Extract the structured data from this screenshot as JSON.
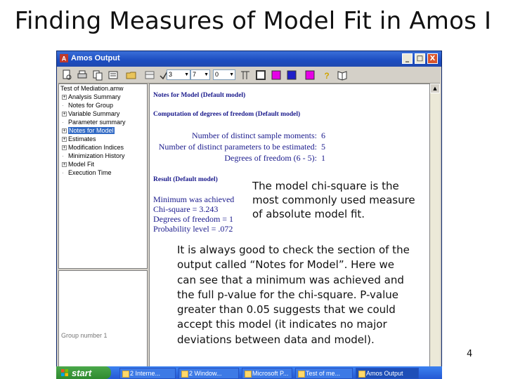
{
  "slide": {
    "title": "Finding Measures of Model Fit in Amos I",
    "page_number": "4"
  },
  "window": {
    "title": "Amos Output",
    "buttons": {
      "minimize": "_",
      "maximize": "□",
      "close": "X"
    }
  },
  "toolbar": {
    "combo1": "3",
    "combo2": "7",
    "combo3": "0",
    "icons": [
      "preview-icon",
      "print-icon",
      "copy-icon",
      "options-icon",
      "open-icon",
      "copy-table-icon",
      "check-icon",
      "decimals-icon",
      "columns-icon",
      "table-grid-icon",
      "table-border-icon",
      "color-magenta-icon",
      "color-blue-icon",
      "help-icon",
      "book-icon"
    ]
  },
  "tree": {
    "root": "Test of Mediation.amw",
    "items": [
      {
        "label": "Analysis Summary",
        "expand": "+",
        "selected": false
      },
      {
        "label": "Notes for Group",
        "expand": "",
        "selected": false
      },
      {
        "label": "Variable Summary",
        "expand": "+",
        "selected": false
      },
      {
        "label": "Parameter summary",
        "expand": "",
        "selected": false
      },
      {
        "label": "Notes for Model",
        "expand": "+",
        "selected": true
      },
      {
        "label": "Estimates",
        "expand": "+",
        "selected": false
      },
      {
        "label": "Modification Indices",
        "expand": "+",
        "selected": false
      },
      {
        "label": "Minimization History",
        "expand": "",
        "selected": false
      },
      {
        "label": "Model Fit",
        "expand": "+",
        "selected": false
      },
      {
        "label": "Execution Time",
        "expand": "",
        "selected": false
      }
    ]
  },
  "groups_panel": {
    "label": "Group number 1"
  },
  "content": {
    "notes_heading": "Notes for Model (Default model)",
    "computation_heading": "Computation of degrees of freedom (Default model)",
    "df_rows": [
      {
        "label": "Number of distinct sample moments:",
        "value": "6"
      },
      {
        "label": "Number of distinct parameters to be estimated:",
        "value": "5"
      },
      {
        "label": "Degrees of freedom (6 - 5):",
        "value": "1"
      }
    ],
    "result_heading": "Result (Default model)",
    "result_lines": [
      "Minimum was achieved",
      "Chi-square = 3.243",
      "Degrees of freedom = 1",
      "Probability level = .072"
    ]
  },
  "callouts": {
    "chi_square": "The model chi-square is the most commonly used measure of absolute model fit.",
    "notes_for_model": "It is always good to check the section of the output called “Notes for Model”. Here we can see that a minimum was achieved and the full p-value for the chi-square. P-value greater than 0.05 suggests that we could accept this model (it indicates no major deviations between data and model)."
  },
  "taskbar": {
    "start_label": "start",
    "tasks": [
      {
        "label": "2 Interne...",
        "active": false
      },
      {
        "label": "2 Window...",
        "active": false
      },
      {
        "label": "Microsoft P...",
        "active": false
      },
      {
        "label": "Test of me...",
        "active": false
      },
      {
        "label": "Amos Output",
        "active": true
      }
    ]
  }
}
